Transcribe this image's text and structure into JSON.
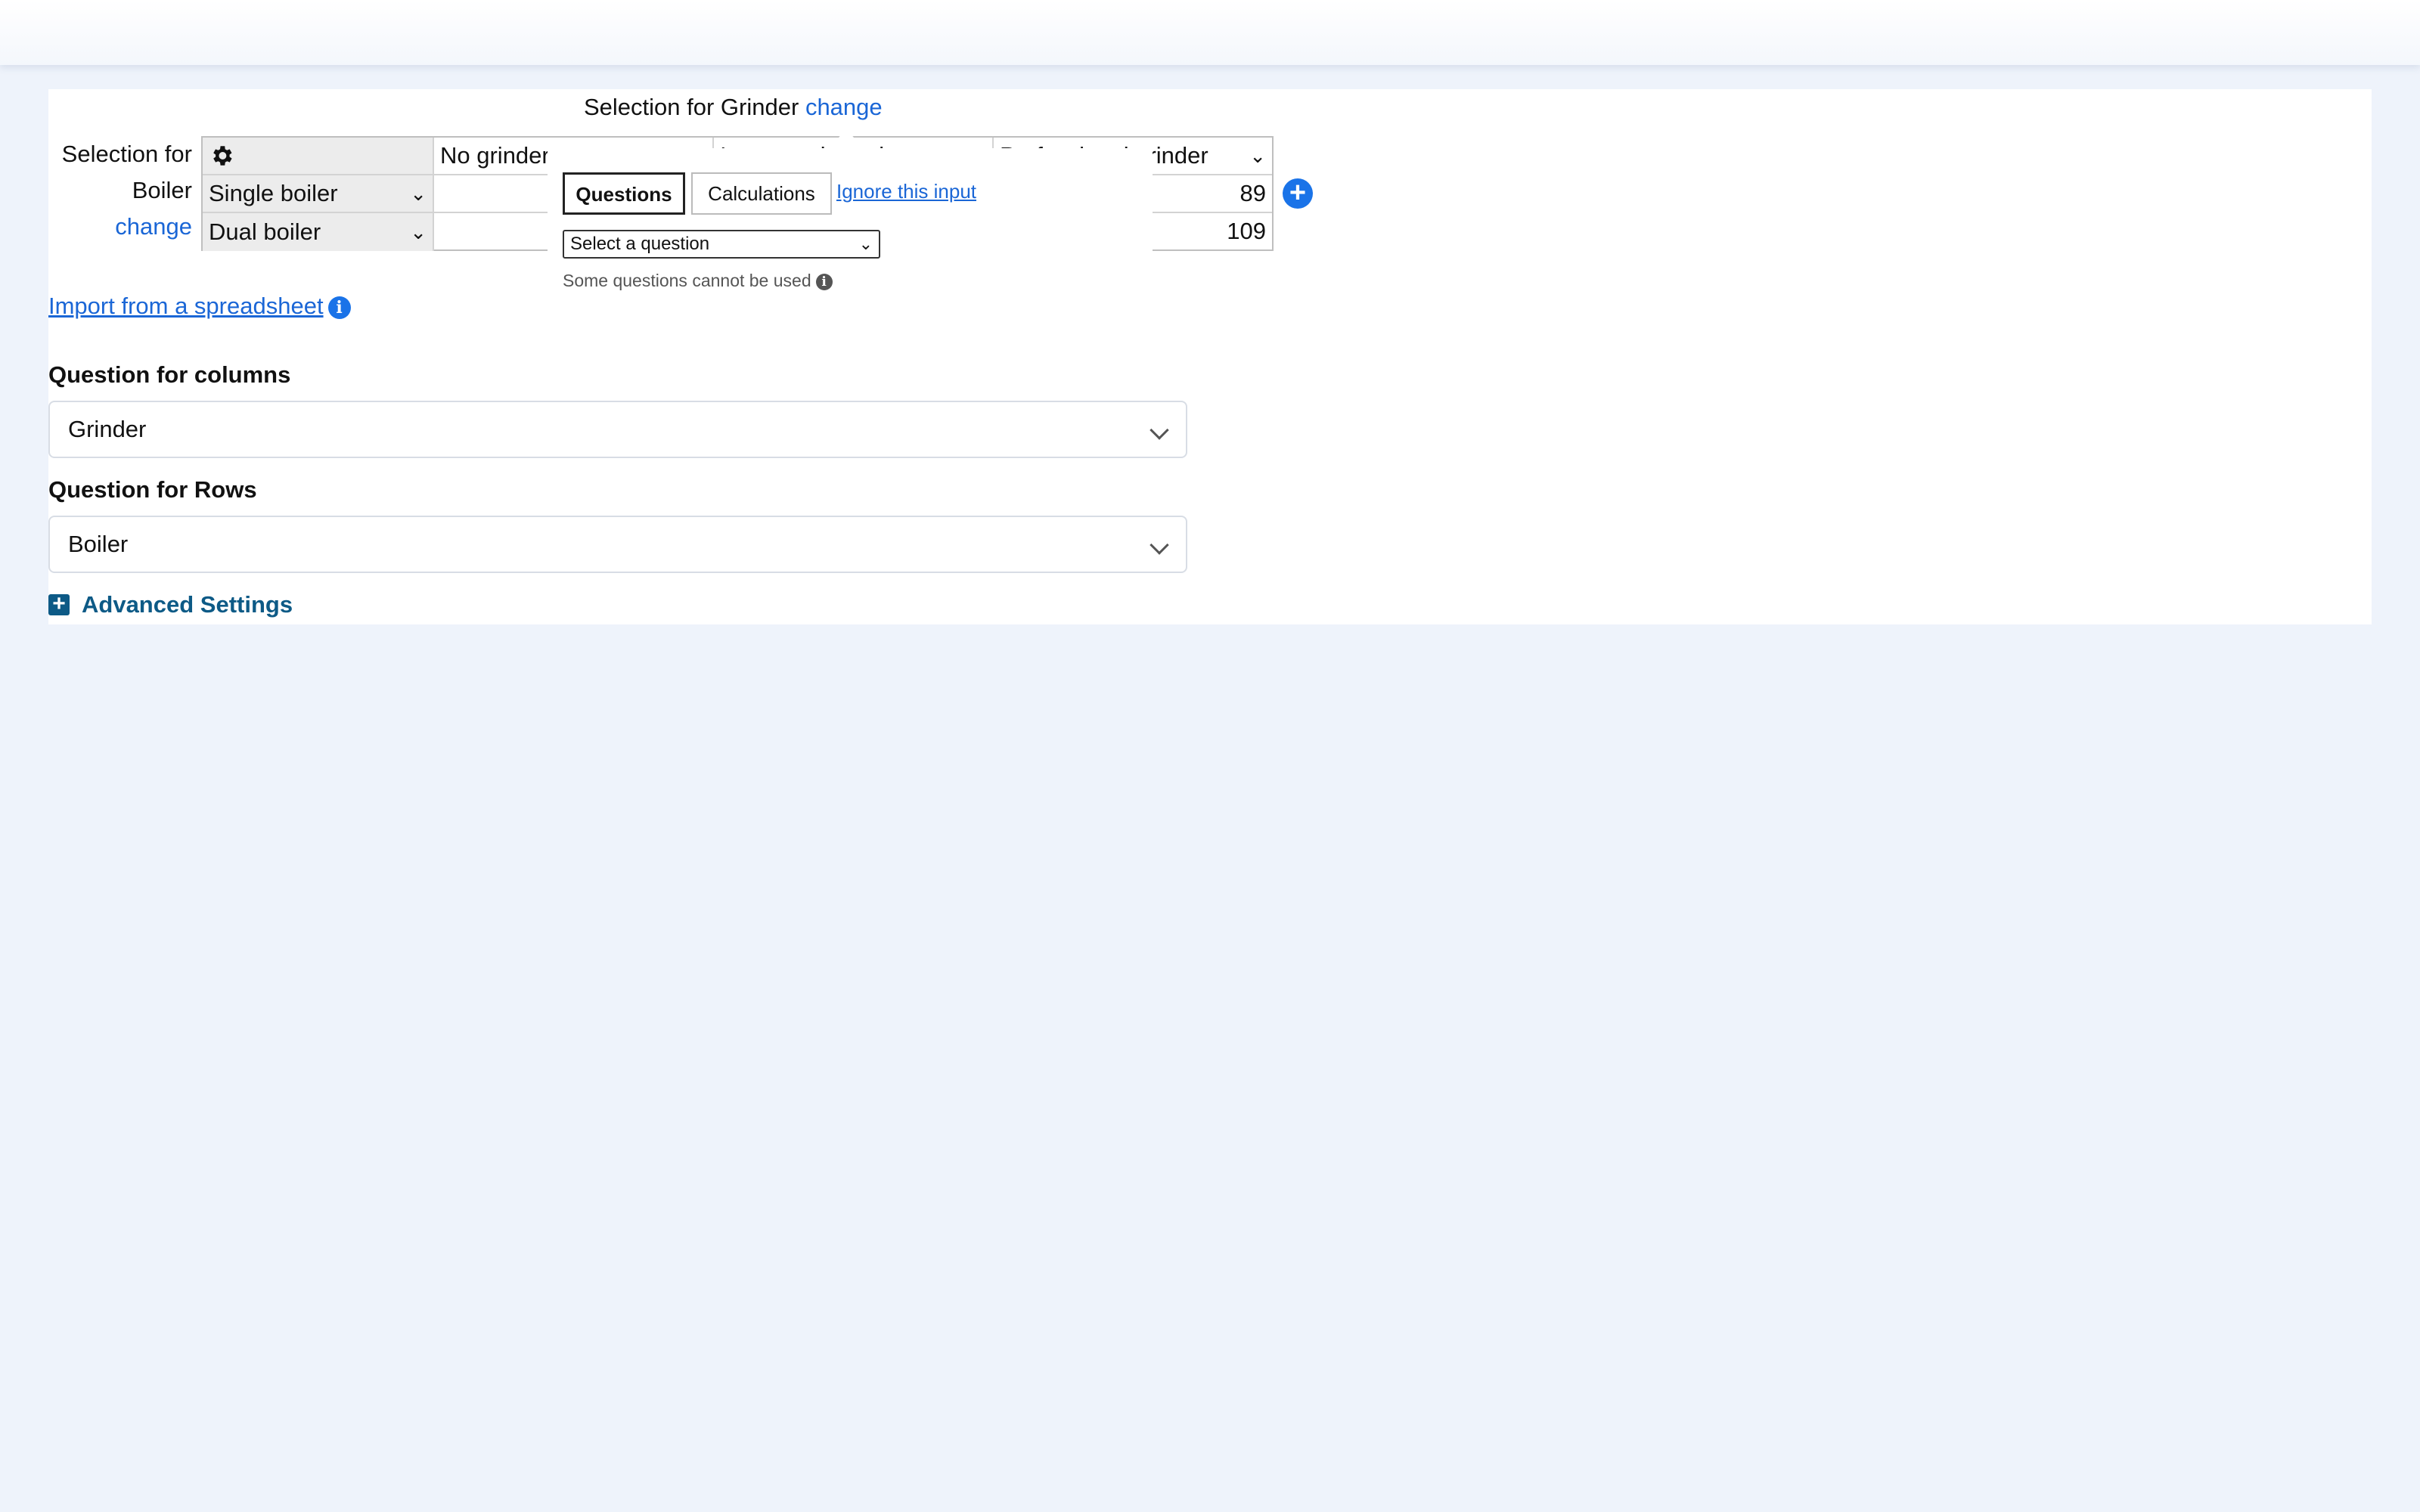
{
  "grid_header": {
    "prefix": "Selection for Grinder",
    "change": "change"
  },
  "row_labels": {
    "line1": "Selection for",
    "line2": "Boiler",
    "line3": "change"
  },
  "columns": [
    "No grinder",
    "Integrated grinder",
    "Professional grinder"
  ],
  "rows": [
    {
      "label": "Single boiler",
      "last_value": "89"
    },
    {
      "label": "Dual boiler",
      "last_value": "109"
    }
  ],
  "popup": {
    "tabs": [
      "Questions",
      "Calculations"
    ],
    "ignore": "Ignore this input",
    "select_placeholder": "Select a question",
    "note": "Some questions cannot be used"
  },
  "import_link": "Import from a spreadsheet",
  "columns_question": {
    "label": "Question for columns",
    "value": "Grinder"
  },
  "rows_question": {
    "label": "Question for Rows",
    "value": "Boiler"
  },
  "advanced": "Advanced Settings",
  "icons": {
    "settings": "gear-icon",
    "add": "plus-circle-icon",
    "info": "info-icon"
  }
}
